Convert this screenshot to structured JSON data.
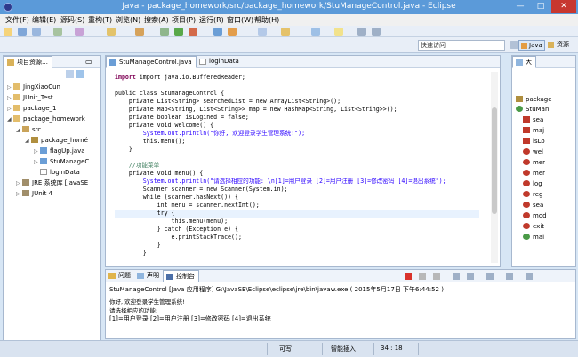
{
  "window": {
    "title": "Java - package_homework/src/package_homework/StuManageControl.java - Eclipse",
    "minimize_label": "—",
    "maximize_label": "□",
    "close_label": "✕"
  },
  "menu": [
    "文件(F)",
    "编辑(E)",
    "源码(S)",
    "重构(T)",
    "浏览(N)",
    "搜索(A)",
    "项目(P)",
    "运行(R)",
    "窗口(W)",
    "帮助(H)"
  ],
  "toolbar": {
    "quick_access_label": "快速访问",
    "perspective_java": "Java",
    "perspective_resource": "资源"
  },
  "explorer": {
    "tab_label": "项目资源…",
    "tree": [
      {
        "label": "JingXiaoCun",
        "arrow": "▷"
      },
      {
        "label": "JUnit_Test",
        "arrow": "▷"
      },
      {
        "label": "package_1",
        "arrow": "▷"
      },
      {
        "label": "package_homework",
        "arrow": "◢"
      },
      {
        "label": "src",
        "arrow": "◢"
      },
      {
        "label": "package_homé",
        "arrow": "◢"
      },
      {
        "label": "flagUp.java",
        "arrow": "▷"
      },
      {
        "label": "StuManageC",
        "arrow": "▷"
      },
      {
        "label": "loginData",
        "arrow": ""
      },
      {
        "label": "JRE 系统库 [JavaSE",
        "arrow": "▷"
      },
      {
        "label": "JUnit 4",
        "arrow": "▷"
      }
    ]
  },
  "editor": {
    "tabs": [
      "StuManageControl.java",
      "loginData"
    ],
    "lines": [
      "import java.io.BufferedReader;",
      "",
      "public class StuManageControl {",
      "    private List<String> searchedList = new ArrayList<String>();",
      "    private Map<String, List<String>> map = new HashMap<String, List<String>>();",
      "    private boolean isLogined = false;",
      "    private void welcome() {",
      "        System.out.println(\"你好, 欢迎登录学生管理系统!\");",
      "        this.menu();",
      "    }",
      "",
      "    //功能菜单",
      "    private void menu() {",
      "        System.out.println(\"请选择相应的功能: \\n[1]=用户登录 [2]=用户注册 [3]=修改密码 [4]=退出系统\");",
      "        Scanner scanner = new Scanner(System.in);",
      "        while (scanner.hasNext()) {",
      "            int menu = scanner.nextInt();",
      "            try {",
      "                this.menu(menu);",
      "            } catch (Exception e) {",
      "                e.printStackTrace();",
      "            }",
      "        }"
    ]
  },
  "outline": {
    "tab_label": "大",
    "items": [
      "package",
      "StuMan",
      "sea",
      "maj",
      "isLo",
      "wel",
      "mer",
      "mer",
      "log",
      "reg",
      "sea",
      "mod",
      "exit",
      "mai"
    ]
  },
  "console": {
    "tabs": [
      "问题",
      "声明",
      "控制台"
    ],
    "header": "StuManageControl [Java 应用程序] G:\\JavaSE\\Eclipse\\eclipse\\jre\\bin\\javaw.exe ( 2015年5月17日 下午6:44:52 )",
    "lines": [
      "你好, 欢迎登录学生管理系统!",
      "请选择相应的功能:",
      "[1]=用户登录 [2]=用户注册 [3]=修改密码 [4]=退出系统"
    ]
  },
  "status": {
    "writable": "可写",
    "insert_mode": "智能插入",
    "position": "34 : 18"
  }
}
